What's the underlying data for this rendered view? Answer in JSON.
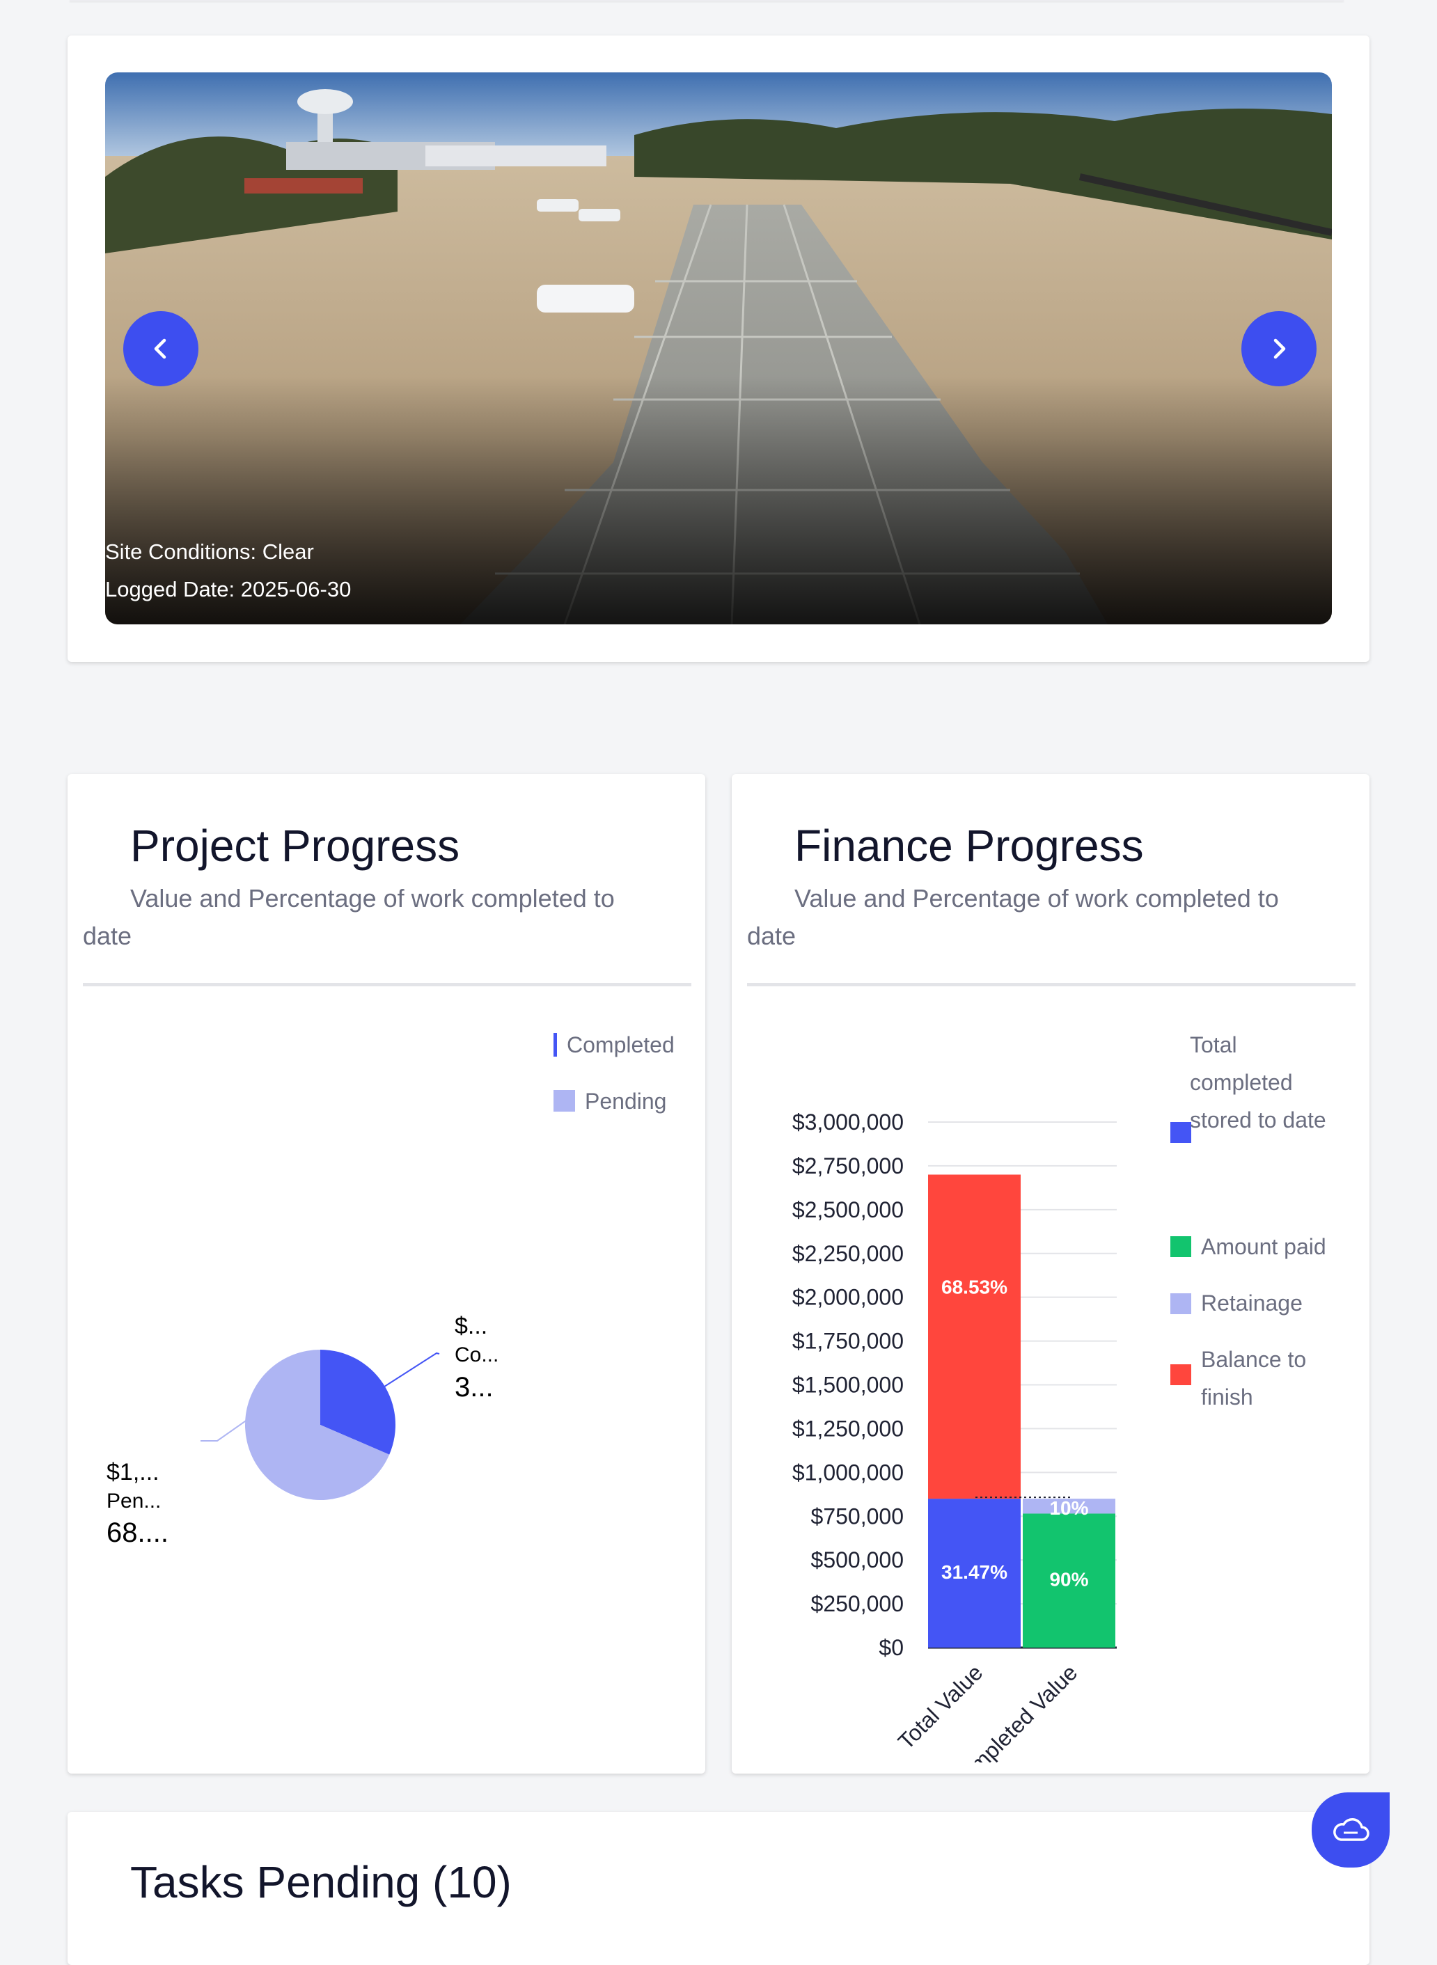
{
  "carousel": {
    "site_conditions": "Site Conditions: Clear",
    "logged_date": "Logged Date: 2025-06-30",
    "prev_icon": "chevron-left-icon",
    "next_icon": "chevron-right-icon"
  },
  "project_progress": {
    "title": "Project Progress",
    "subtitle": "Value and Percentage of work completed to date",
    "legend": [
      "Completed",
      "Pending"
    ],
    "label_completed": [
      "$...",
      "Co...",
      "3..."
    ],
    "label_pending": [
      "$1,...",
      "Pen...",
      "68...."
    ],
    "colors": {
      "completed": "#4455f5",
      "pending": "#aeb5f3"
    },
    "chart_data": {
      "type": "pie",
      "categories": [
        "Completed",
        "Pending"
      ],
      "values": [
        31.47,
        68.53
      ]
    }
  },
  "finance_progress": {
    "title": "Finance Progress",
    "subtitle": "Value and Percentage of work completed to date",
    "legend": [
      {
        "lines": [
          "Total",
          "completed",
          "stored to date"
        ],
        "color": "#4455f5"
      },
      {
        "lines": [
          "Amount paid"
        ],
        "color": "#12c46e"
      },
      {
        "lines": [
          "Retainage"
        ],
        "color": "#aeb5f3"
      },
      {
        "lines": [
          "Balance to",
          "finish"
        ],
        "color": "#ff463d"
      }
    ],
    "chart_data": {
      "type": "bar",
      "stacked": true,
      "categories": [
        "Total Value",
        "Completed Value"
      ],
      "ylim": [
        0,
        3000000
      ],
      "yticks": [
        "$0",
        "$250,000",
        "$500,000",
        "$750,000",
        "$1,000,000",
        "$1,250,000",
        "$1,500,000",
        "$1,750,000",
        "$2,000,000",
        "$2,250,000",
        "$2,500,000",
        "$2,750,000",
        "$3,000,000"
      ],
      "series": [
        {
          "name": "Total completed stored to date",
          "color": "#4455f5",
          "values": [
            850000,
            0
          ],
          "labels": [
            "31.47%",
            ""
          ]
        },
        {
          "name": "Balance to finish",
          "color": "#ff463d",
          "values": [
            1850000,
            0
          ],
          "labels": [
            "68.53%",
            ""
          ]
        },
        {
          "name": "Amount paid",
          "color": "#12c46e",
          "values": [
            0,
            765000
          ],
          "labels": [
            "",
            "90%"
          ]
        },
        {
          "name": "Retainage",
          "color": "#aeb5f3",
          "values": [
            0,
            85000
          ],
          "labels": [
            "",
            "10%"
          ]
        }
      ]
    }
  },
  "tasks": {
    "title": "Tasks Pending (10)"
  },
  "fab": {
    "icon": "cloud-icon"
  }
}
